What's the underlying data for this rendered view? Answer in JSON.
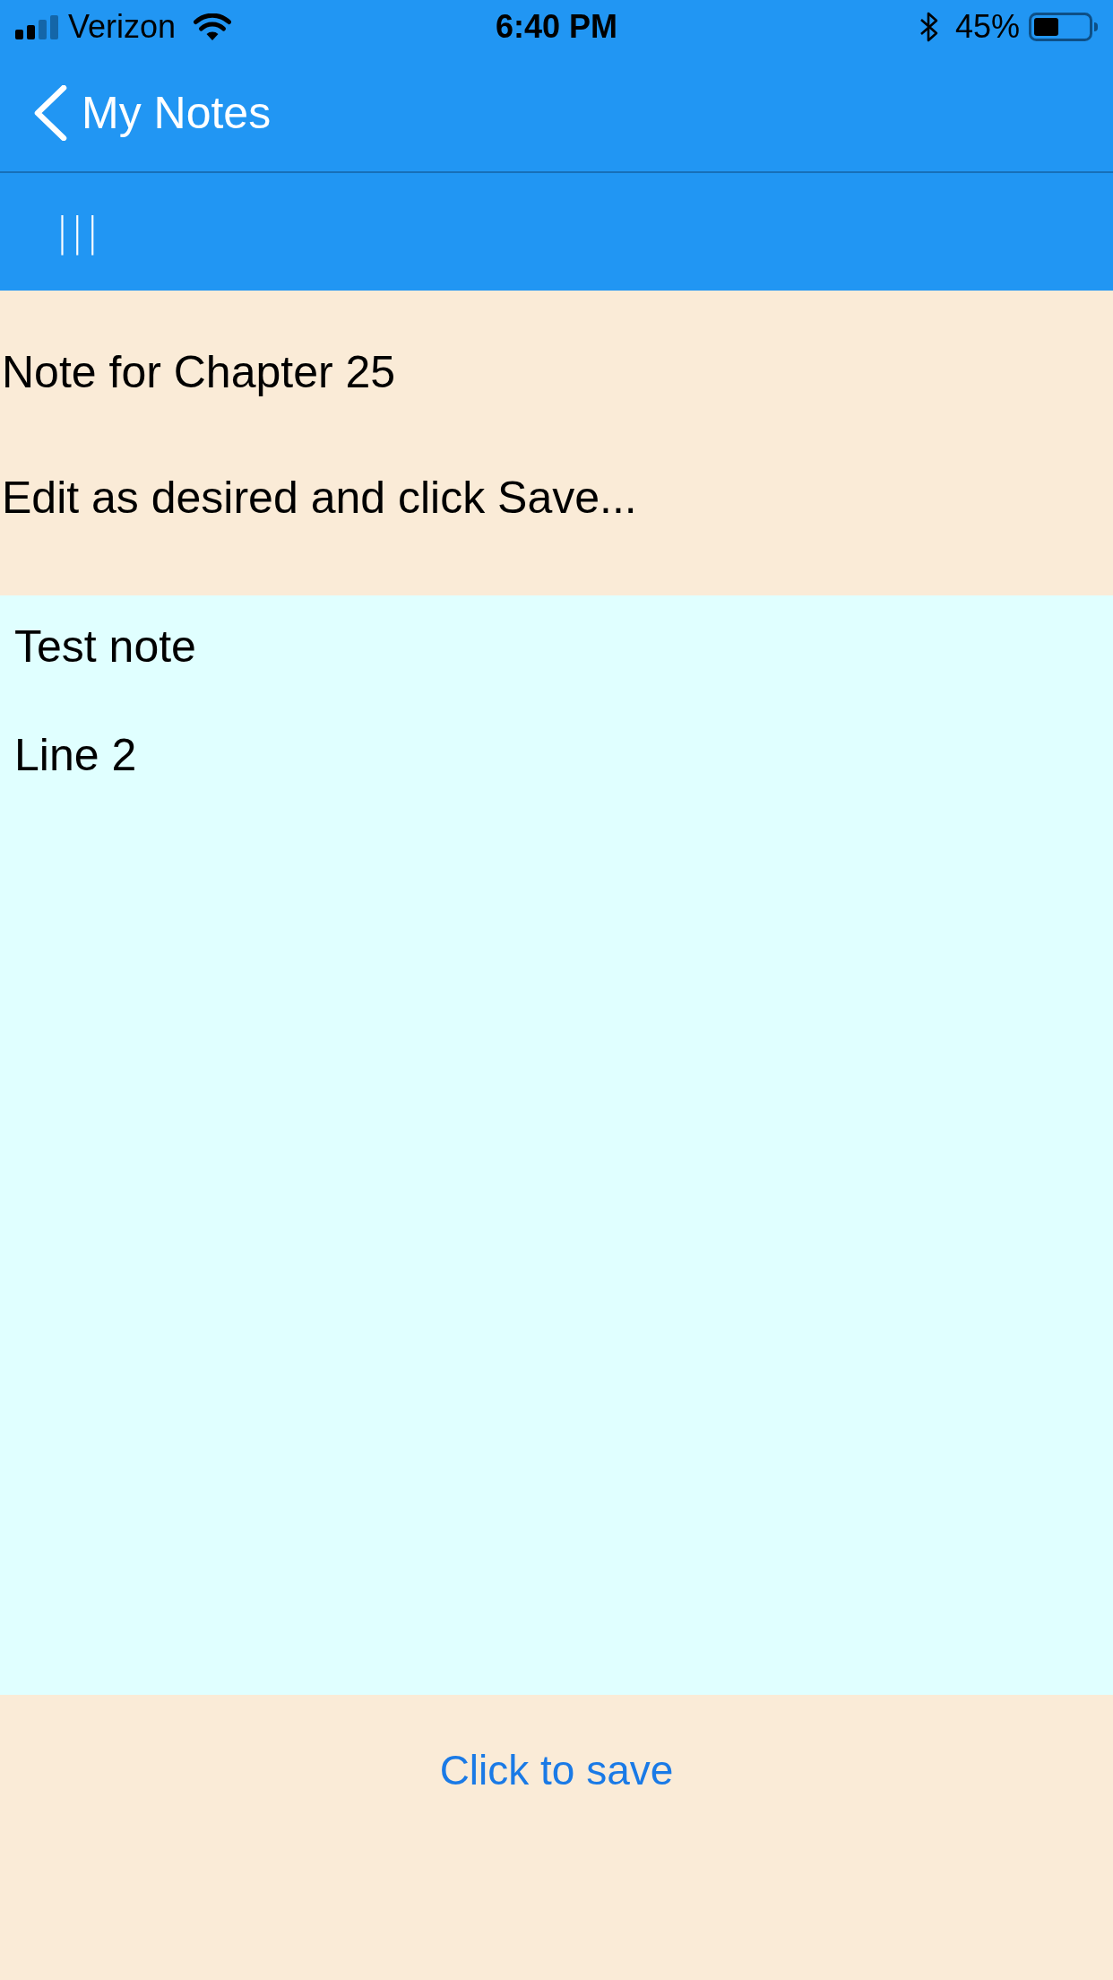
{
  "status_bar": {
    "carrier": "Verizon",
    "time": "6:40 PM",
    "battery": "45%"
  },
  "nav_bar": {
    "back_button": {
      "label": "My Notes"
    }
  },
  "toolbar": {
    "menu_button": {
      "label": "|||"
    }
  },
  "header": {
    "title": "Note for Chapter 25",
    "instructions": "Edit as desired and click Save..."
  },
  "note_field": {
    "value": "Test note\n\nLine 2"
  },
  "save_link": {
    "label": "Click to save"
  }
}
